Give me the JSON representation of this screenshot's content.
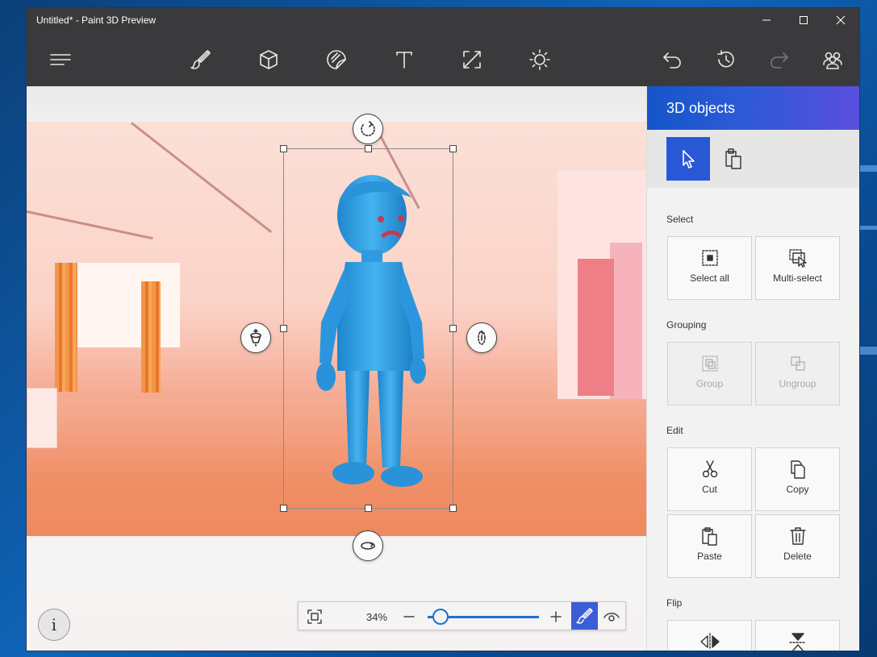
{
  "window": {
    "title": "Untitled* - Paint 3D Preview"
  },
  "toolbar": {
    "items": [
      {
        "name": "menu",
        "icon": "hamburger-menu-icon"
      },
      {
        "name": "brushes",
        "icon": "brush-icon"
      },
      {
        "name": "3d-objects",
        "icon": "cube-icon"
      },
      {
        "name": "stickers",
        "icon": "sticker-icon"
      },
      {
        "name": "text",
        "icon": "text-icon"
      },
      {
        "name": "canvas",
        "icon": "resize-canvas-icon"
      },
      {
        "name": "effects",
        "icon": "sun-icon"
      },
      {
        "name": "undo",
        "icon": "undo-icon"
      },
      {
        "name": "history",
        "icon": "history-icon"
      },
      {
        "name": "redo",
        "icon": "redo-icon",
        "disabled": true
      },
      {
        "name": "remix3d",
        "icon": "community-icon"
      }
    ]
  },
  "canvas": {
    "zoom_percent": "34%",
    "zoom_level": 0.34
  },
  "panel": {
    "title": "3D objects",
    "sections": {
      "select": {
        "label": "Select",
        "select_all": "Select all",
        "multi_select": "Multi-select"
      },
      "grouping": {
        "label": "Grouping",
        "group": "Group",
        "ungroup": "Ungroup"
      },
      "edit": {
        "label": "Edit",
        "cut": "Cut",
        "copy": "Copy",
        "paste": "Paste",
        "delete": "Delete"
      },
      "flip": {
        "label": "Flip"
      }
    }
  },
  "colors": {
    "accent": "#2958d6",
    "toolbar_bg": "#3a3a3c",
    "header_gradient_start": "#1556c9",
    "header_gradient_end": "#5a4fe0",
    "figure": "#3aa6e8"
  }
}
